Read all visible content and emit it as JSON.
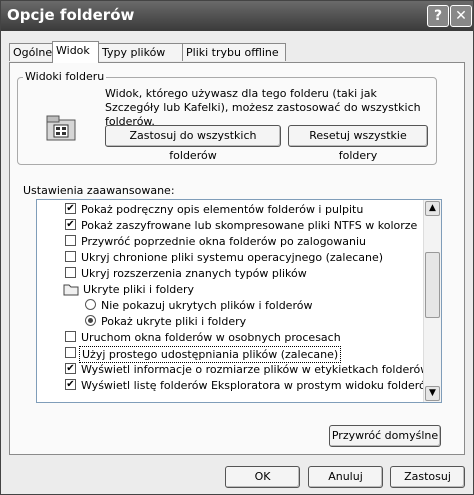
{
  "window": {
    "title": "Opcje folderów",
    "help_label": "?",
    "close_label": "✕"
  },
  "tabs": [
    {
      "label": "Ogólne"
    },
    {
      "label": "Widok"
    },
    {
      "label": "Typy plików"
    },
    {
      "label": "Pliki trybu offline"
    }
  ],
  "active_tab": "Widok",
  "folder_views": {
    "group_title": "Widoki folderu",
    "description": "Widok, którego używasz dla tego folderu (taki jak Szczegóły lub Kafelki), możesz zastosować do wszystkich folderów.",
    "apply_all_label": "Zastosuj do wszystkich folderów",
    "reset_all_label": "Resetuj wszystkie foldery"
  },
  "advanced": {
    "label": "Ustawienia zaawansowane:",
    "items": [
      {
        "type": "checkbox",
        "checked": true,
        "label": "Pokaż podręczny opis elementów folderów i pulpitu"
      },
      {
        "type": "checkbox",
        "checked": true,
        "label": "Pokaż zaszyfrowane lub skompresowane pliki NTFS w kolorze"
      },
      {
        "type": "checkbox",
        "checked": false,
        "label": "Przywróć poprzednie okna folderów po zalogowaniu"
      },
      {
        "type": "checkbox",
        "checked": false,
        "label": "Ukryj chronione pliki systemu operacyjnego (zalecane)"
      },
      {
        "type": "checkbox",
        "checked": false,
        "label": "Ukryj rozszerzenia znanych typów plików"
      },
      {
        "type": "folder",
        "label": "Ukryte pliki i foldery"
      },
      {
        "type": "radio",
        "checked": false,
        "label": "Nie pokazuj ukrytych plików i folderów"
      },
      {
        "type": "radio",
        "checked": true,
        "label": "Pokaż ukryte pliki i foldery"
      },
      {
        "type": "checkbox",
        "checked": false,
        "label": "Uruchom okna folderów w osobnych procesach"
      },
      {
        "type": "checkbox",
        "checked": false,
        "label": "Użyj prostego udostępniania plików (zalecane)",
        "focused": true
      },
      {
        "type": "checkbox",
        "checked": true,
        "label": "Wyświetl informacje o rozmiarze plików w etykietkach folderów"
      },
      {
        "type": "checkbox",
        "checked": true,
        "label": "Wyświetl listę folderów Eksploratora w prostym widoku folderów"
      }
    ],
    "restore_defaults_label": "Przywróć domyślne"
  },
  "footer": {
    "ok_label": "OK",
    "cancel_label": "Anuluj",
    "apply_label": "Zastosuj"
  }
}
